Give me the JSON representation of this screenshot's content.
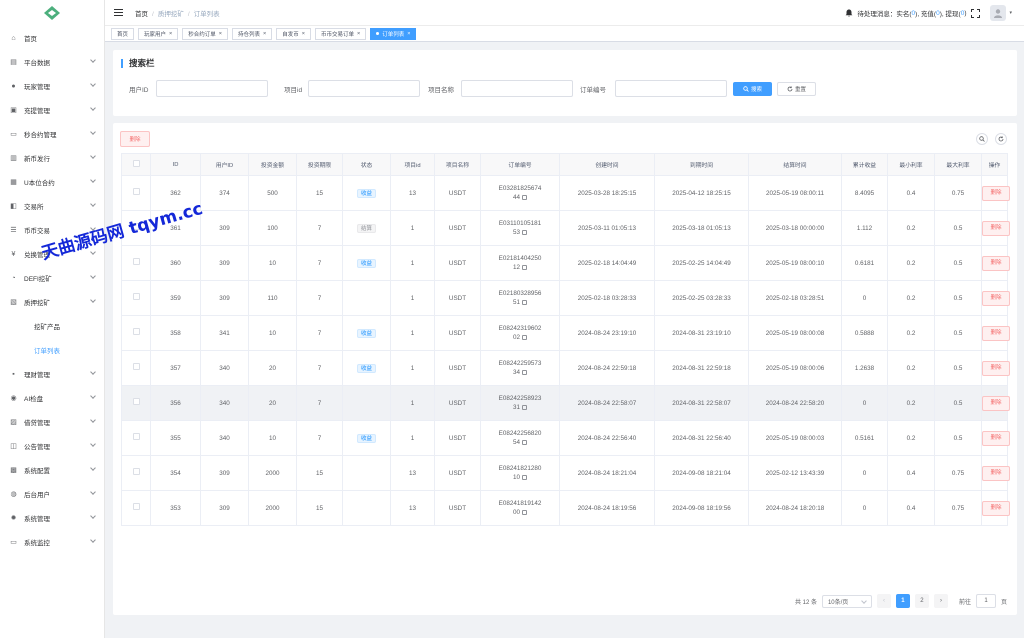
{
  "sidebar": {
    "items": [
      {
        "label": "首页",
        "icon": "dashboard-icon",
        "chevron": false
      },
      {
        "label": "平台数据",
        "icon": "chart-icon",
        "chevron": true
      },
      {
        "label": "玩家管理",
        "icon": "user-icon",
        "chevron": true
      },
      {
        "label": "充提管理",
        "icon": "wallet-icon",
        "chevron": true
      },
      {
        "label": "秒合约管理",
        "icon": "contract-icon",
        "chevron": true
      },
      {
        "label": "新币发行",
        "icon": "coin-icon",
        "chevron": true
      },
      {
        "label": "U本位合约",
        "icon": "u-contract-icon",
        "chevron": true
      },
      {
        "label": "交易所",
        "icon": "exchange-icon",
        "chevron": true
      },
      {
        "label": "币币交易",
        "icon": "trade-icon",
        "chevron": true
      },
      {
        "label": "兑换管理",
        "icon": "yen-icon",
        "chevron": true
      },
      {
        "label": "DEFI挖矿",
        "icon": "defi-icon",
        "chevron": true
      },
      {
        "label": "质押挖矿",
        "icon": "mining-icon",
        "chevron": true
      }
    ],
    "subitems": [
      {
        "label": "挖矿产品"
      },
      {
        "label": "订单列表"
      }
    ],
    "items_after": [
      {
        "label": "理财管理",
        "icon": "finance-icon"
      },
      {
        "label": "AI检盘",
        "icon": "ai-icon"
      },
      {
        "label": "借贷管理",
        "icon": "loan-icon"
      },
      {
        "label": "公告管理",
        "icon": "notice-icon"
      },
      {
        "label": "系统配置",
        "icon": "config-icon"
      },
      {
        "label": "后台用户",
        "icon": "admin-icon"
      },
      {
        "label": "系统管理",
        "icon": "gear-icon"
      },
      {
        "label": "系统监控",
        "icon": "monitor-icon"
      }
    ]
  },
  "header": {
    "breadcrumb": [
      "首页",
      "质押挖矿",
      "订单列表"
    ],
    "notify": {
      "label": "待处理消息：",
      "kyc_label": "实名(",
      "kyc_count": "0",
      "deposit_label": "), 充值(",
      "deposit_count": "0",
      "withdraw_label": "), 提现(",
      "withdraw_count": "0",
      "close": ")"
    }
  },
  "tags": [
    {
      "label": "首页",
      "active": false,
      "closable": false
    },
    {
      "label": "玩家用户",
      "active": false,
      "closable": true
    },
    {
      "label": "秒合约订单",
      "active": false,
      "closable": true
    },
    {
      "label": "持仓列表",
      "active": false,
      "closable": true
    },
    {
      "label": "自发币",
      "active": false,
      "closable": true
    },
    {
      "label": "币币交易订单",
      "active": false,
      "closable": true
    },
    {
      "label": "订单列表",
      "active": true,
      "closable": true
    }
  ],
  "search": {
    "title": "搜索栏",
    "fields": [
      {
        "label": "用户ID"
      },
      {
        "label": "项目id"
      },
      {
        "label": "项目名称"
      },
      {
        "label": "订单编号"
      }
    ],
    "search_btn": "搜索",
    "reset_btn": "重置"
  },
  "table": {
    "delete_btn": "删除",
    "columns": [
      "ID",
      "用户ID",
      "投资金额",
      "投资期限",
      "状态",
      "项目id",
      "项目名称",
      "订单编号",
      "创建时间",
      "到期时间",
      "结算时间",
      "累计收益",
      "最小利率",
      "最大利率",
      "操作"
    ],
    "rows": [
      {
        "id": "362",
        "uid": "374",
        "amount": "500",
        "term": "15",
        "status": "收益",
        "pid": "13",
        "pname": "USDT",
        "order_a": "E03281825674",
        "order_b": "44",
        "created": "2025-03-28 18:25:15",
        "expire": "2025-04-12 18:25:15",
        "settle": "2025-05-19 08:00:11",
        "profit": "8.4095",
        "min": "0.4",
        "max": "0.75",
        "action": "删除"
      },
      {
        "id": "361",
        "uid": "309",
        "amount": "100",
        "term": "7",
        "status": "结算",
        "pid": "1",
        "pname": "USDT",
        "order_a": "E03110105181",
        "order_b": "53",
        "created": "2025-03-11 01:05:13",
        "expire": "2025-03-18 01:05:13",
        "settle": "2025-03-18 00:00:00",
        "profit": "1.112",
        "min": "0.2",
        "max": "0.5",
        "action": "删除"
      },
      {
        "id": "360",
        "uid": "309",
        "amount": "10",
        "term": "7",
        "status": "收益",
        "pid": "1",
        "pname": "USDT",
        "order_a": "E02181404250",
        "order_b": "12",
        "created": "2025-02-18 14:04:49",
        "expire": "2025-02-25 14:04:49",
        "settle": "2025-05-19 08:00:10",
        "profit": "0.6181",
        "min": "0.2",
        "max": "0.5",
        "action": "删除"
      },
      {
        "id": "359",
        "uid": "309",
        "amount": "110",
        "term": "7",
        "status": "",
        "pid": "1",
        "pname": "USDT",
        "order_a": "E02180328956",
        "order_b": "51",
        "created": "2025-02-18 03:28:33",
        "expire": "2025-02-25 03:28:33",
        "settle": "2025-02-18 03:28:51",
        "profit": "0",
        "min": "0.2",
        "max": "0.5",
        "action": "删除"
      },
      {
        "id": "358",
        "uid": "341",
        "amount": "10",
        "term": "7",
        "status": "收益",
        "pid": "1",
        "pname": "USDT",
        "order_a": "E08242319602",
        "order_b": "02",
        "created": "2024-08-24 23:19:10",
        "expire": "2024-08-31 23:19:10",
        "settle": "2025-05-19 08:00:08",
        "profit": "0.5888",
        "min": "0.2",
        "max": "0.5",
        "action": "删除"
      },
      {
        "id": "357",
        "uid": "340",
        "amount": "20",
        "term": "7",
        "status": "收益",
        "pid": "1",
        "pname": "USDT",
        "order_a": "E08242259573",
        "order_b": "34",
        "created": "2024-08-24 22:59:18",
        "expire": "2024-08-31 22:59:18",
        "settle": "2025-05-19 08:00:06",
        "profit": "1.2638",
        "min": "0.2",
        "max": "0.5",
        "action": "删除"
      },
      {
        "id": "356",
        "uid": "340",
        "amount": "20",
        "term": "7",
        "status": "",
        "pid": "1",
        "pname": "USDT",
        "order_a": "E08242258923",
        "order_b": "31",
        "created": "2024-08-24 22:58:07",
        "expire": "2024-08-31 22:58:07",
        "settle": "2024-08-24 22:58:20",
        "profit": "0",
        "min": "0.2",
        "max": "0.5",
        "action": "删除"
      },
      {
        "id": "355",
        "uid": "340",
        "amount": "10",
        "term": "7",
        "status": "收益",
        "pid": "1",
        "pname": "USDT",
        "order_a": "E08242256820",
        "order_b": "54",
        "created": "2024-08-24 22:56:40",
        "expire": "2024-08-31 22:56:40",
        "settle": "2025-05-19 08:00:03",
        "profit": "0.5161",
        "min": "0.2",
        "max": "0.5",
        "action": "删除"
      },
      {
        "id": "354",
        "uid": "309",
        "amount": "2000",
        "term": "15",
        "status": "",
        "pid": "13",
        "pname": "USDT",
        "order_a": "E08241821280",
        "order_b": "10",
        "created": "2024-08-24 18:21:04",
        "expire": "2024-09-08 18:21:04",
        "settle": "2025-02-12 13:43:39",
        "profit": "0",
        "min": "0.4",
        "max": "0.75",
        "action": "删除"
      },
      {
        "id": "353",
        "uid": "309",
        "amount": "2000",
        "term": "15",
        "status": "",
        "pid": "13",
        "pname": "USDT",
        "order_a": "E08241819142",
        "order_b": "00",
        "created": "2024-08-24 18:19:56",
        "expire": "2024-09-08 18:19:56",
        "settle": "2024-08-24 18:20:18",
        "profit": "0",
        "min": "0.4",
        "max": "0.75",
        "action": "删除"
      }
    ]
  },
  "pagination": {
    "total": "共 12 条",
    "page_size": "10条/页",
    "pages": [
      "1",
      "2"
    ],
    "current": "1",
    "goto_label": "前往",
    "goto_value": "1",
    "page_label": "页"
  },
  "watermark": "天曲源码网 tqym.cc",
  "colors": {
    "primary": "#409eff",
    "danger": "#f56c6c",
    "watermark": "#1428d8"
  }
}
